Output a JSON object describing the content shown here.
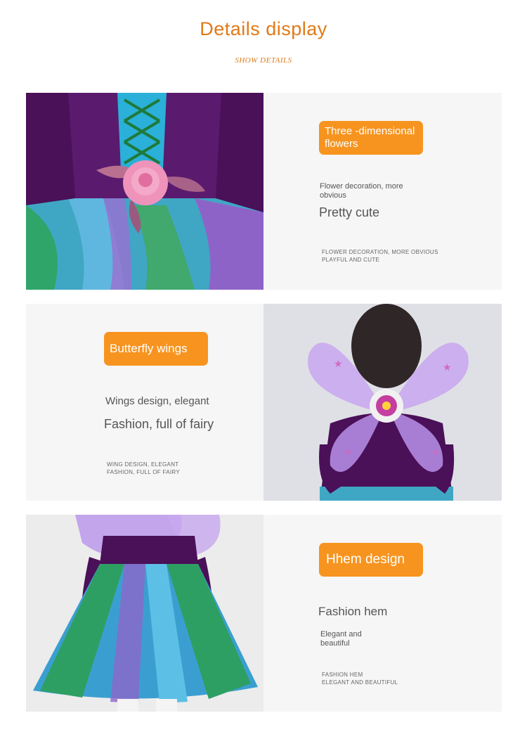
{
  "header": {
    "title": "Details display",
    "subtitle": "SHOW DETAILS"
  },
  "sections": [
    {
      "badge": "Three -dimensional flowers",
      "line1": "Flower decoration, more obvious",
      "line2": "Pretty cute",
      "caps1": "FLOWER DECORATION, MORE OBVIOUS",
      "caps2": "PLAYFUL AND CUTE"
    },
    {
      "badge": "Butterfly wings",
      "line1": "Wings design, elegant",
      "line2": "Fashion, full of fairy",
      "caps1": "WING DESIGN, ELEGANT",
      "caps2": "FASHION, FULL OF FAIRY"
    },
    {
      "badge": "Hhem design",
      "line1": "Fashion hem",
      "line2": "Elegant and beautiful",
      "caps1": "FASHION HEM",
      "caps2": "ELEGANT AND BEAUTIFUL"
    }
  ],
  "colors": {
    "accent": "#f7941f",
    "title": "#e07a17",
    "panel": "#f6f6f6"
  }
}
